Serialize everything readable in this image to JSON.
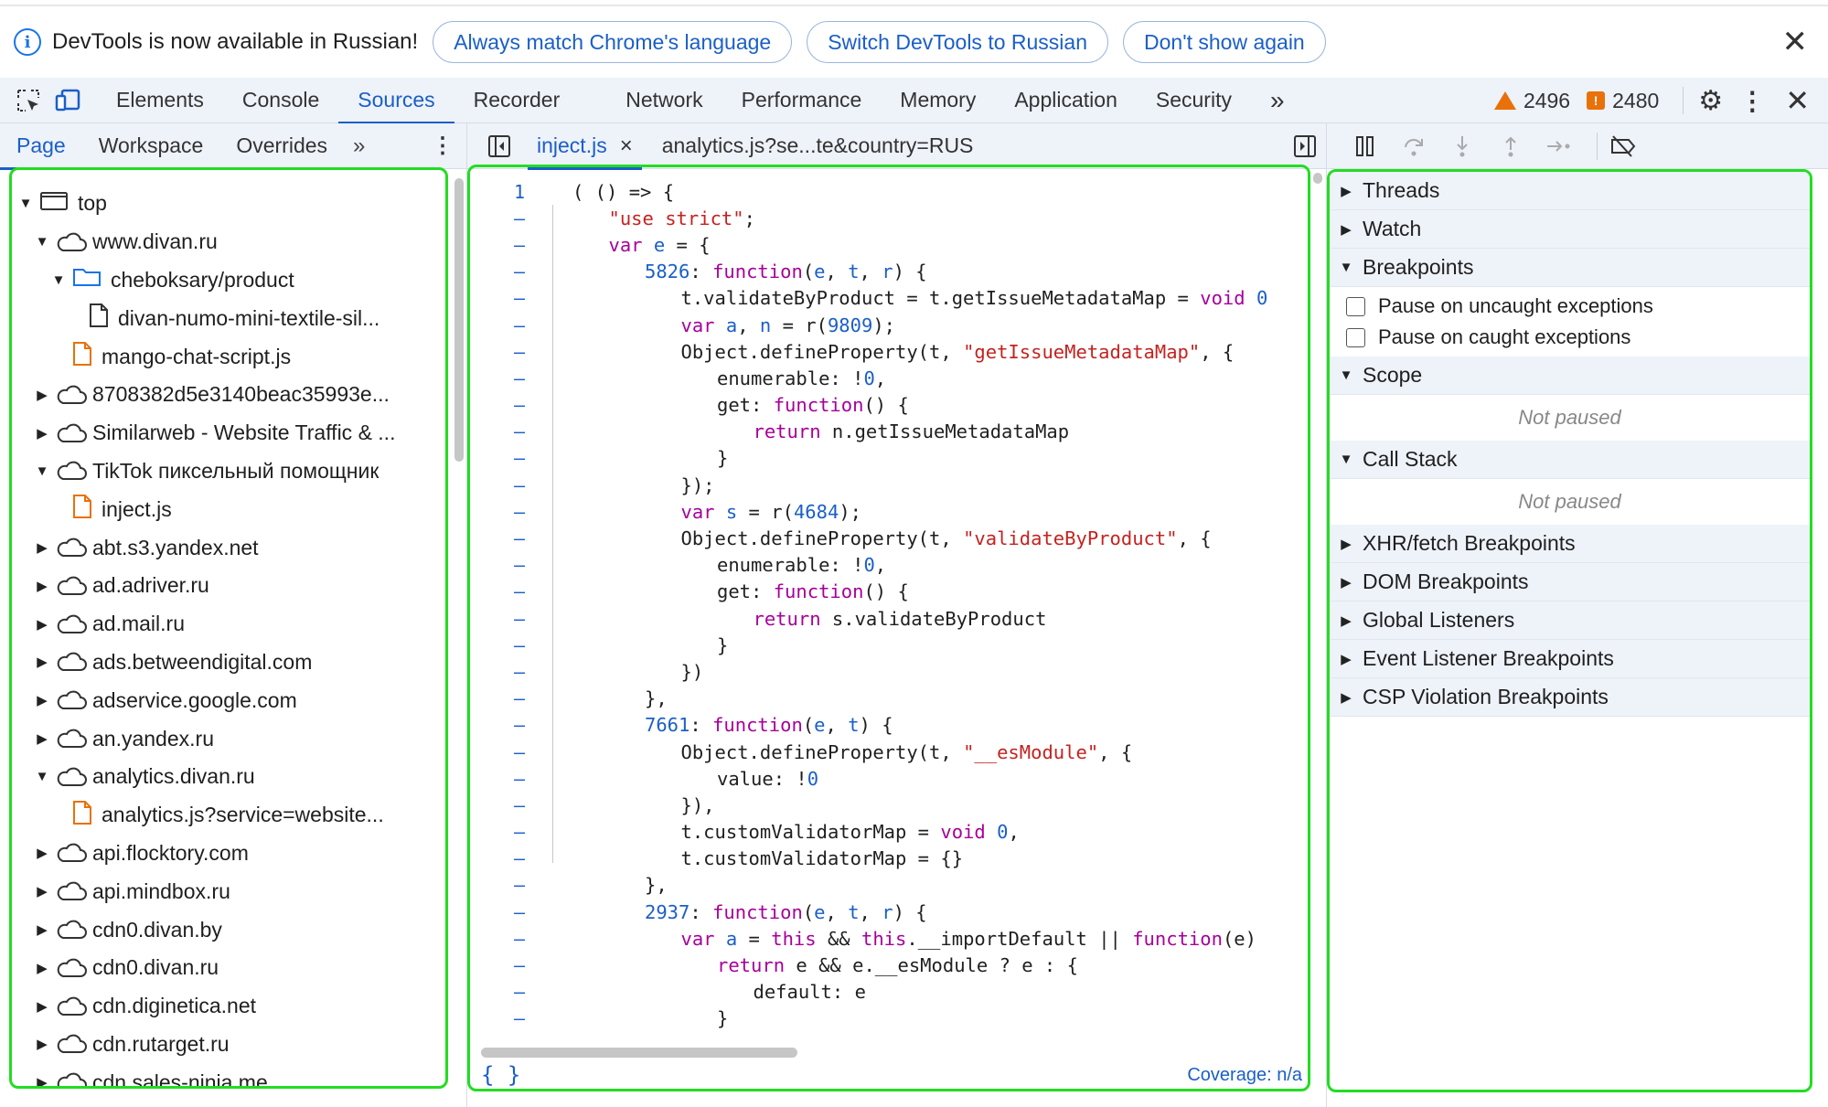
{
  "infobar": {
    "text": "DevTools is now available in Russian!",
    "btn_match": "Always match Chrome's language",
    "btn_switch": "Switch DevTools to Russian",
    "btn_dont": "Don't show again",
    "close": "✕"
  },
  "maintabs": {
    "elements": "Elements",
    "console": "Console",
    "sources": "Sources",
    "recorder": "Recorder",
    "network": "Network",
    "performance": "Performance",
    "memory": "Memory",
    "application": "Application",
    "security": "Security",
    "more": "»",
    "warnings": "2496",
    "errors": "2480"
  },
  "subtabs": {
    "page": "Page",
    "workspace": "Workspace",
    "overrides": "Overrides",
    "more": "»"
  },
  "tree": [
    {
      "indent": 0,
      "arrow": "▼",
      "icon": "frame",
      "label": "top"
    },
    {
      "indent": 1,
      "arrow": "▼",
      "icon": "cloud",
      "label": "www.divan.ru"
    },
    {
      "indent": 2,
      "arrow": "▼",
      "icon": "folder",
      "label": "cheboksary/product"
    },
    {
      "indent": 3,
      "arrow": "",
      "icon": "doc",
      "label": "divan-numo-mini-textile-sil..."
    },
    {
      "indent": 2,
      "arrow": "",
      "icon": "script",
      "label": "mango-chat-script.js"
    },
    {
      "indent": 1,
      "arrow": "▶",
      "icon": "cloud",
      "label": "8708382d5e3140beac35993e..."
    },
    {
      "indent": 1,
      "arrow": "▶",
      "icon": "cloud",
      "label": "Similarweb - Website Traffic & ..."
    },
    {
      "indent": 1,
      "arrow": "▼",
      "icon": "cloud",
      "label": "TikTok пиксельный помощник"
    },
    {
      "indent": 2,
      "arrow": "",
      "icon": "script",
      "label": "inject.js"
    },
    {
      "indent": 1,
      "arrow": "▶",
      "icon": "cloud",
      "label": "abt.s3.yandex.net"
    },
    {
      "indent": 1,
      "arrow": "▶",
      "icon": "cloud",
      "label": "ad.adriver.ru"
    },
    {
      "indent": 1,
      "arrow": "▶",
      "icon": "cloud",
      "label": "ad.mail.ru"
    },
    {
      "indent": 1,
      "arrow": "▶",
      "icon": "cloud",
      "label": "ads.betweendigital.com"
    },
    {
      "indent": 1,
      "arrow": "▶",
      "icon": "cloud",
      "label": "adservice.google.com"
    },
    {
      "indent": 1,
      "arrow": "▶",
      "icon": "cloud",
      "label": "an.yandex.ru"
    },
    {
      "indent": 1,
      "arrow": "▼",
      "icon": "cloud",
      "label": "analytics.divan.ru"
    },
    {
      "indent": 2,
      "arrow": "",
      "icon": "script",
      "label": "analytics.js?service=website..."
    },
    {
      "indent": 1,
      "arrow": "▶",
      "icon": "cloud",
      "label": "api.flocktory.com"
    },
    {
      "indent": 1,
      "arrow": "▶",
      "icon": "cloud",
      "label": "api.mindbox.ru"
    },
    {
      "indent": 1,
      "arrow": "▶",
      "icon": "cloud",
      "label": "cdn0.divan.by"
    },
    {
      "indent": 1,
      "arrow": "▶",
      "icon": "cloud",
      "label": "cdn0.divan.ru"
    },
    {
      "indent": 1,
      "arrow": "▶",
      "icon": "cloud",
      "label": "cdn.diginetica.net"
    },
    {
      "indent": 1,
      "arrow": "▶",
      "icon": "cloud",
      "label": "cdn.rutarget.ru"
    },
    {
      "indent": 1,
      "arrow": "▶",
      "icon": "cloud",
      "label": "cdn.sales-ninja.me"
    }
  ],
  "editor": {
    "tab_active": "inject.js",
    "tab_close": "×",
    "tab_other": "analytics.js?se...te&country=RUS",
    "braces": "{ }",
    "coverage": "Coverage: n/a",
    "lines": [
      {
        "n": "1",
        "indent": 0,
        "tokens": [
          [
            "",
            "( () => {"
          ]
        ]
      },
      {
        "n": "–",
        "indent": 1,
        "tokens": [
          [
            "str",
            "\"use strict\""
          ],
          [
            "",
            ";"
          ]
        ]
      },
      {
        "n": "–",
        "indent": 1,
        "tokens": [
          [
            "kw",
            "var "
          ],
          [
            "prm",
            "e"
          ],
          [
            "",
            " = {"
          ]
        ]
      },
      {
        "n": "–",
        "indent": 2,
        "tokens": [
          [
            "num",
            "5826"
          ],
          [
            "",
            ": "
          ],
          [
            "kw",
            "function"
          ],
          [
            "",
            "("
          ],
          [
            "prm",
            "e"
          ],
          [
            "",
            ", "
          ],
          [
            "prm",
            "t"
          ],
          [
            "",
            ", "
          ],
          [
            "prm",
            "r"
          ],
          [
            "",
            ") {"
          ]
        ]
      },
      {
        "n": "–",
        "indent": 3,
        "tokens": [
          [
            "",
            "t.validateByProduct = t.getIssueMetadataMap = "
          ],
          [
            "kw",
            "void "
          ],
          [
            "num",
            "0"
          ]
        ]
      },
      {
        "n": "–",
        "indent": 3,
        "tokens": [
          [
            "kw",
            "var "
          ],
          [
            "prm",
            "a"
          ],
          [
            "",
            ", "
          ],
          [
            "prm",
            "n"
          ],
          [
            "",
            " = r("
          ],
          [
            "num",
            "9809"
          ],
          [
            "",
            ");"
          ]
        ]
      },
      {
        "n": "–",
        "indent": 3,
        "tokens": [
          [
            "",
            "Object.defineProperty(t, "
          ],
          [
            "str",
            "\"getIssueMetadataMap\""
          ],
          [
            "",
            ", {"
          ]
        ]
      },
      {
        "n": "–",
        "indent": 4,
        "tokens": [
          [
            "",
            "enumerable: !"
          ],
          [
            "num",
            "0"
          ],
          [
            "",
            ","
          ]
        ]
      },
      {
        "n": "–",
        "indent": 4,
        "tokens": [
          [
            "",
            "get: "
          ],
          [
            "kw",
            "function"
          ],
          [
            "",
            "() {"
          ]
        ]
      },
      {
        "n": "–",
        "indent": 5,
        "tokens": [
          [
            "kw",
            "return "
          ],
          [
            "",
            "n.getIssueMetadataMap"
          ]
        ]
      },
      {
        "n": "–",
        "indent": 4,
        "tokens": [
          [
            "",
            "}"
          ]
        ]
      },
      {
        "n": "–",
        "indent": 3,
        "tokens": [
          [
            "",
            "});"
          ]
        ]
      },
      {
        "n": "–",
        "indent": 3,
        "tokens": [
          [
            "kw",
            "var "
          ],
          [
            "prm",
            "s"
          ],
          [
            "",
            " = r("
          ],
          [
            "num",
            "4684"
          ],
          [
            "",
            ");"
          ]
        ]
      },
      {
        "n": "–",
        "indent": 3,
        "tokens": [
          [
            "",
            "Object.defineProperty(t, "
          ],
          [
            "str",
            "\"validateByProduct\""
          ],
          [
            "",
            ", {"
          ]
        ]
      },
      {
        "n": "–",
        "indent": 4,
        "tokens": [
          [
            "",
            "enumerable: !"
          ],
          [
            "num",
            "0"
          ],
          [
            "",
            ","
          ]
        ]
      },
      {
        "n": "–",
        "indent": 4,
        "tokens": [
          [
            "",
            "get: "
          ],
          [
            "kw",
            "function"
          ],
          [
            "",
            "() {"
          ]
        ]
      },
      {
        "n": "–",
        "indent": 5,
        "tokens": [
          [
            "kw",
            "return "
          ],
          [
            "",
            "s.validateByProduct"
          ]
        ]
      },
      {
        "n": "–",
        "indent": 4,
        "tokens": [
          [
            "",
            "}"
          ]
        ]
      },
      {
        "n": "–",
        "indent": 3,
        "tokens": [
          [
            "",
            "})"
          ]
        ]
      },
      {
        "n": "–",
        "indent": 2,
        "tokens": [
          [
            "",
            "},"
          ]
        ]
      },
      {
        "n": "–",
        "indent": 2,
        "tokens": [
          [
            "num",
            "7661"
          ],
          [
            "",
            ": "
          ],
          [
            "kw",
            "function"
          ],
          [
            "",
            "("
          ],
          [
            "prm",
            "e"
          ],
          [
            "",
            ", "
          ],
          [
            "prm",
            "t"
          ],
          [
            "",
            ") {"
          ]
        ]
      },
      {
        "n": "–",
        "indent": 3,
        "tokens": [
          [
            "",
            "Object.defineProperty(t, "
          ],
          [
            "str",
            "\"__esModule\""
          ],
          [
            "",
            ", {"
          ]
        ]
      },
      {
        "n": "–",
        "indent": 4,
        "tokens": [
          [
            "",
            "value: !"
          ],
          [
            "num",
            "0"
          ]
        ]
      },
      {
        "n": "–",
        "indent": 3,
        "tokens": [
          [
            "",
            "}),"
          ]
        ]
      },
      {
        "n": "–",
        "indent": 3,
        "tokens": [
          [
            "",
            "t.customValidatorMap = "
          ],
          [
            "kw",
            "void "
          ],
          [
            "num",
            "0"
          ],
          [
            "",
            ","
          ]
        ]
      },
      {
        "n": "–",
        "indent": 3,
        "tokens": [
          [
            "",
            "t.customValidatorMap = {}"
          ]
        ]
      },
      {
        "n": "–",
        "indent": 2,
        "tokens": [
          [
            "",
            "},"
          ]
        ]
      },
      {
        "n": "–",
        "indent": 2,
        "tokens": [
          [
            "num",
            "2937"
          ],
          [
            "",
            ": "
          ],
          [
            "kw",
            "function"
          ],
          [
            "",
            "("
          ],
          [
            "prm",
            "e"
          ],
          [
            "",
            ", "
          ],
          [
            "prm",
            "t"
          ],
          [
            "",
            ", "
          ],
          [
            "prm",
            "r"
          ],
          [
            "",
            ") {"
          ]
        ]
      },
      {
        "n": "–",
        "indent": 3,
        "tokens": [
          [
            "kw",
            "var "
          ],
          [
            "prm",
            "a"
          ],
          [
            "",
            " = "
          ],
          [
            "kw",
            "this"
          ],
          [
            "",
            " && "
          ],
          [
            "kw",
            "this"
          ],
          [
            "",
            "."
          ],
          [
            "",
            "__importDefault || "
          ],
          [
            "kw",
            "function"
          ],
          [
            "",
            "(e)"
          ]
        ]
      },
      {
        "n": "–",
        "indent": 4,
        "tokens": [
          [
            "kw",
            "return "
          ],
          [
            "",
            "e && e.__esModule ? e : {"
          ]
        ]
      },
      {
        "n": "–",
        "indent": 5,
        "tokens": [
          [
            "",
            "default: e"
          ]
        ]
      },
      {
        "n": "–",
        "indent": 4,
        "tokens": [
          [
            "",
            "}"
          ]
        ]
      }
    ]
  },
  "right": {
    "threads": "Threads",
    "watch": "Watch",
    "breakpoints": "Breakpoints",
    "pause_uncaught": "Pause on uncaught exceptions",
    "pause_caught": "Pause on caught exceptions",
    "scope": "Scope",
    "scope_status": "Not paused",
    "callstack": "Call Stack",
    "callstack_status": "Not paused",
    "xhr": "XHR/fetch Breakpoints",
    "dom": "DOM Breakpoints",
    "global": "Global Listeners",
    "event": "Event Listener Breakpoints",
    "csp": "CSP Violation Breakpoints"
  }
}
